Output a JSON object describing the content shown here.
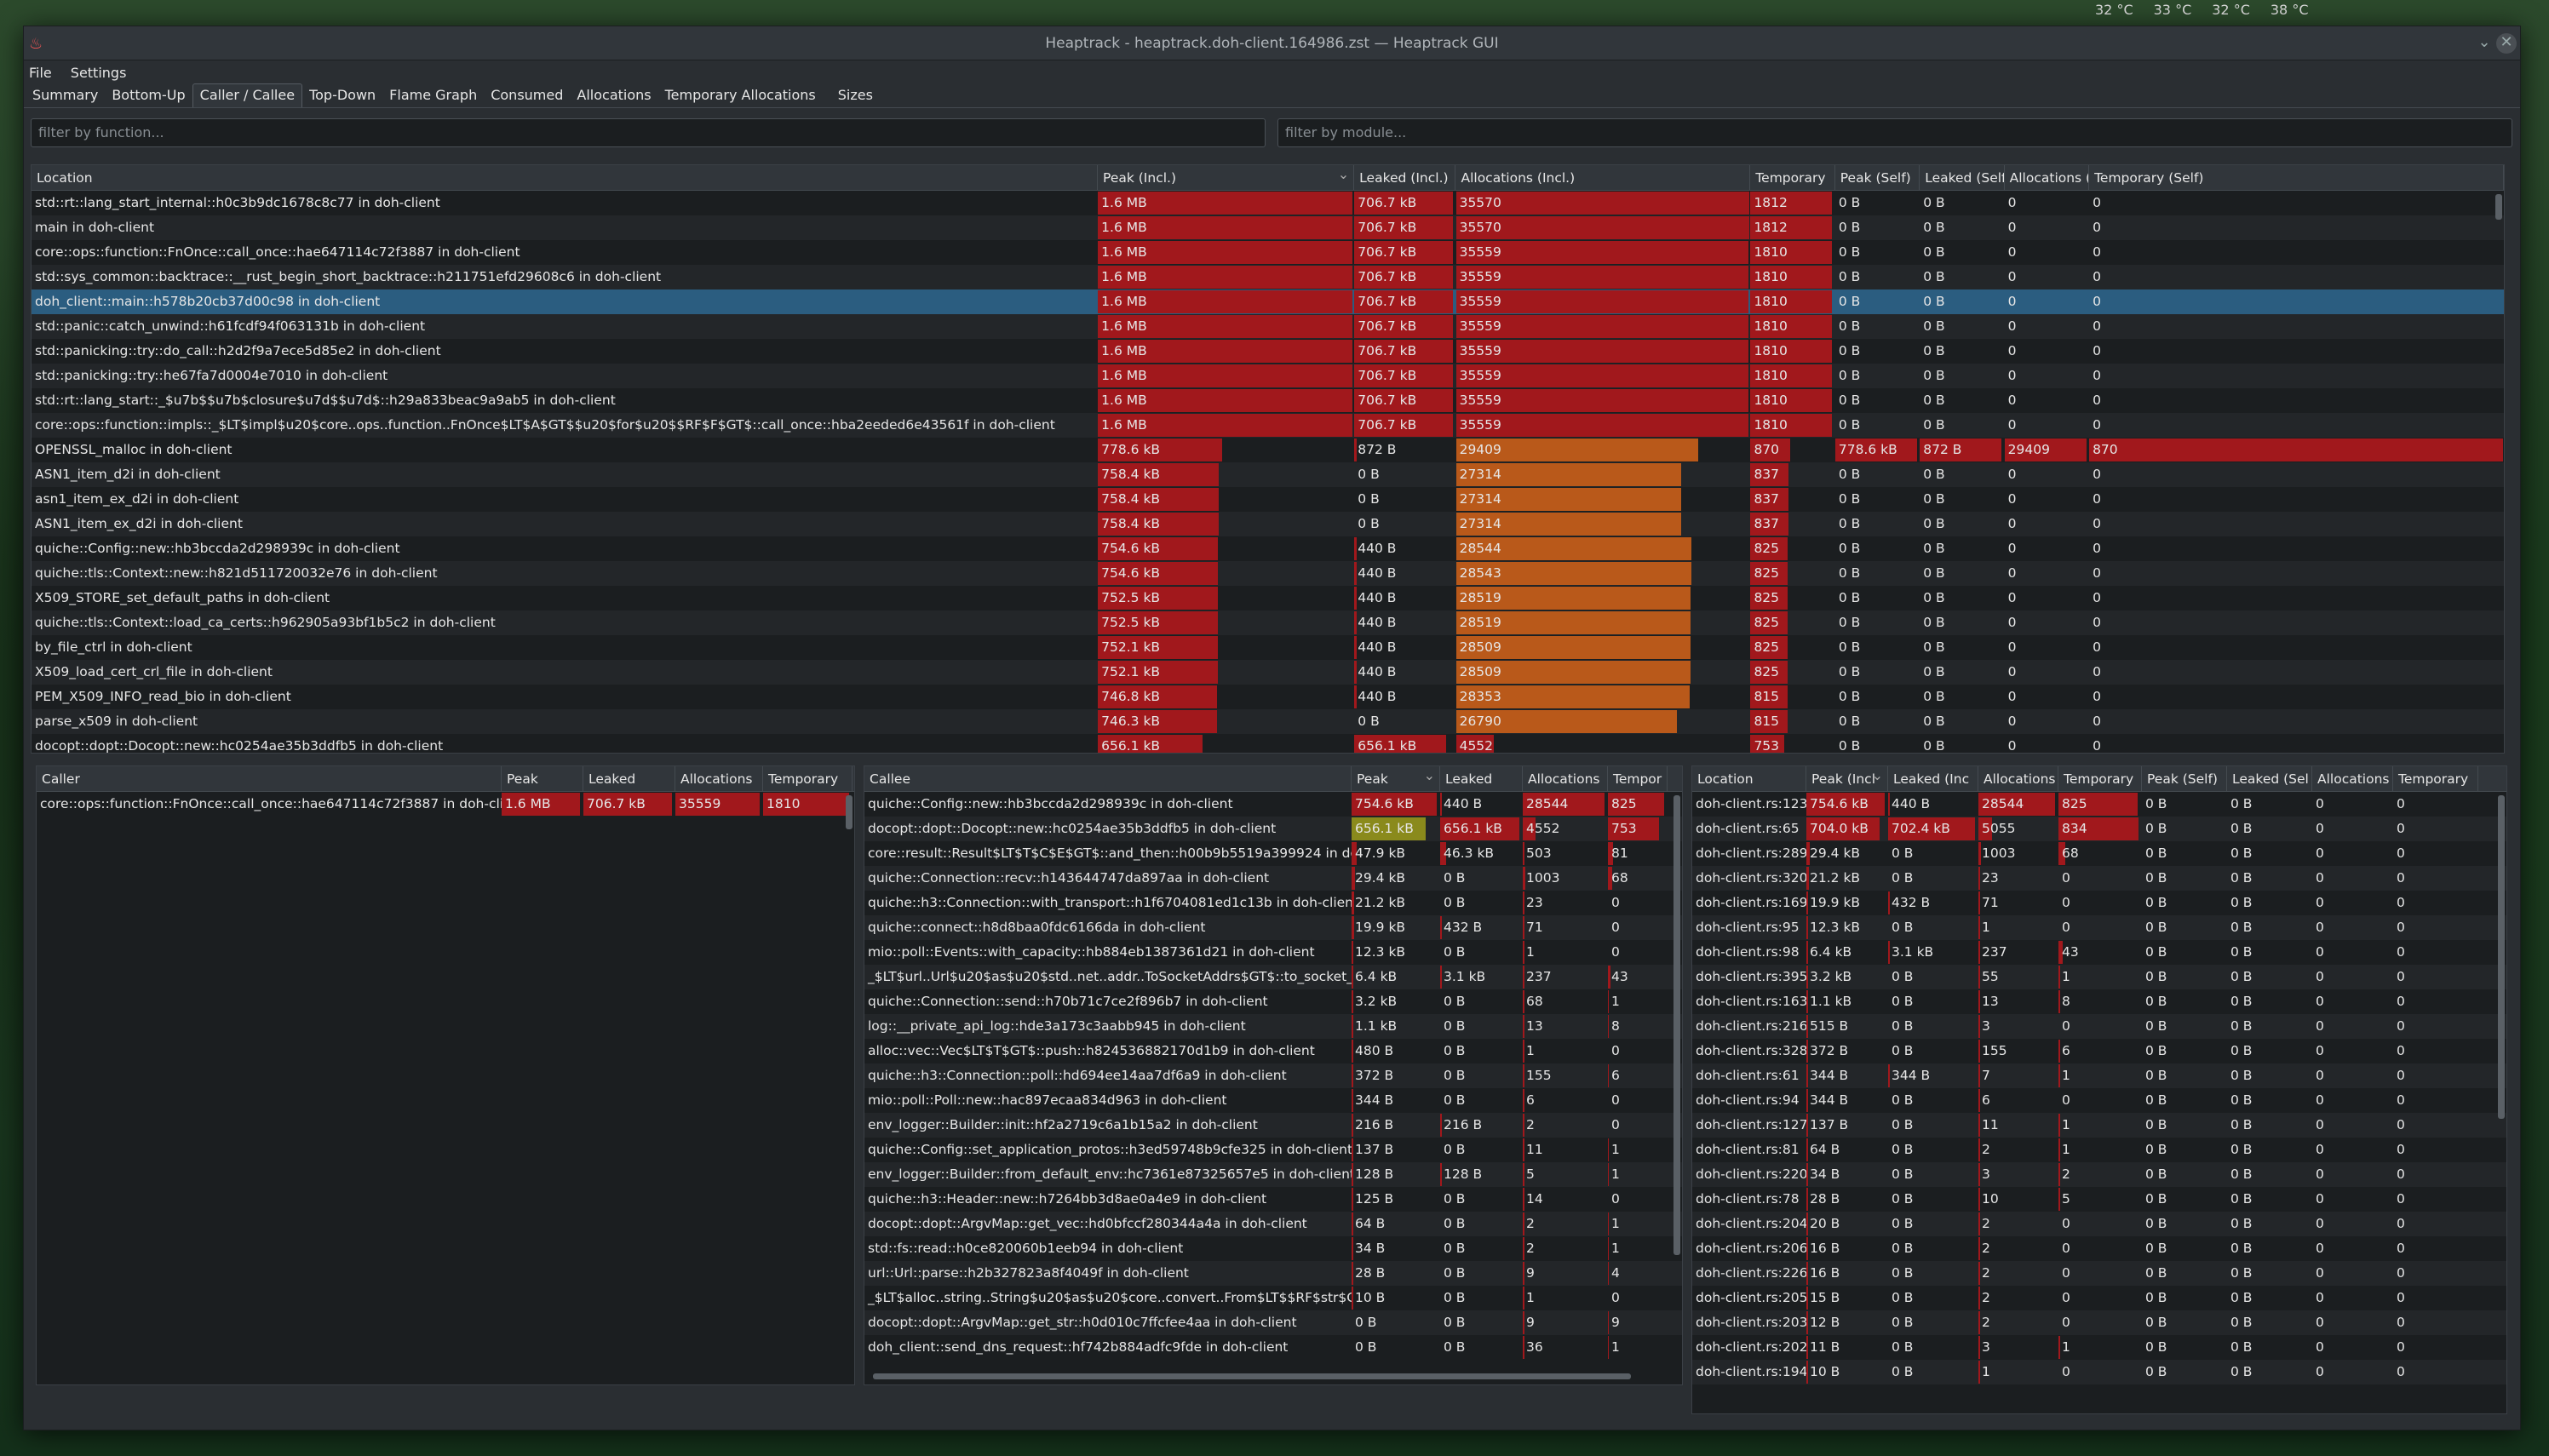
{
  "desktop": {
    "temps": [
      "32 °C",
      "33 °C",
      "32 °C",
      "38 °C"
    ]
  },
  "window": {
    "title": "Heaptrack - heaptrack.doh-client.164986.zst — Heaptrack GUI"
  },
  "menu": [
    "File",
    "Settings"
  ],
  "tabs": [
    "Summary",
    "Bottom-Up",
    "Caller / Callee",
    "Top-Down",
    "Flame Graph",
    "Consumed",
    "Allocations",
    "Temporary Allocations",
    "Sizes"
  ],
  "active_tab": "Caller / Callee",
  "filters": {
    "function_placeholder": "filter by function...",
    "module_placeholder": "filter by module..."
  },
  "main": {
    "headers": [
      "Location",
      "Peak (Incl.)",
      "Leaked (Incl.)",
      "Allocations (Incl.)",
      "Temporary",
      "Peak (Self)",
      "Leaked (Self)",
      "Allocations (",
      "Temporary (Self)"
    ],
    "rows": [
      [
        "std::rt::lang_start_internal::h0c3b9dc1678c8c77 in doh-client",
        "1.6 MB",
        "706.7 kB",
        "35570",
        "1812",
        "0 B",
        "0 B",
        "0",
        "0"
      ],
      [
        "main in doh-client",
        "1.6 MB",
        "706.7 kB",
        "35570",
        "1812",
        "0 B",
        "0 B",
        "0",
        "0"
      ],
      [
        "core::ops::function::FnOnce::call_once::hae647114c72f3887 in doh-client",
        "1.6 MB",
        "706.7 kB",
        "35559",
        "1810",
        "0 B",
        "0 B",
        "0",
        "0"
      ],
      [
        "std::sys_common::backtrace::__rust_begin_short_backtrace::h211751efd29608c6 in doh-client",
        "1.6 MB",
        "706.7 kB",
        "35559",
        "1810",
        "0 B",
        "0 B",
        "0",
        "0"
      ],
      [
        "doh_client::main::h578b20cb37d00c98 in doh-client",
        "1.6 MB",
        "706.7 kB",
        "35559",
        "1810",
        "0 B",
        "0 B",
        "0",
        "0"
      ],
      [
        "std::panic::catch_unwind::h61fcdf94f063131b in doh-client",
        "1.6 MB",
        "706.7 kB",
        "35559",
        "1810",
        "0 B",
        "0 B",
        "0",
        "0"
      ],
      [
        "std::panicking::try::do_call::h2d2f9a7ece5d85e2 in doh-client",
        "1.6 MB",
        "706.7 kB",
        "35559",
        "1810",
        "0 B",
        "0 B",
        "0",
        "0"
      ],
      [
        "std::panicking::try::he67fa7d0004e7010 in doh-client",
        "1.6 MB",
        "706.7 kB",
        "35559",
        "1810",
        "0 B",
        "0 B",
        "0",
        "0"
      ],
      [
        "std::rt::lang_start::_$u7b$$u7b$closure$u7d$$u7d$::h29a833beac9a9ab5 in doh-client",
        "1.6 MB",
        "706.7 kB",
        "35559",
        "1810",
        "0 B",
        "0 B",
        "0",
        "0"
      ],
      [
        "core::ops::function::impls::_$LT$impl$u20$core..ops..function..FnOnce$LT$A$GT$$u20$for$u20$$RF$F$GT$::call_once::hba2eeded6e43561f in doh-client",
        "1.6 MB",
        "706.7 kB",
        "35559",
        "1810",
        "0 B",
        "0 B",
        "0",
        "0"
      ],
      [
        "OPENSSL_malloc in doh-client",
        "778.6 kB",
        "872 B",
        "29409",
        "870",
        "778.6 kB",
        "872 B",
        "29409",
        "870"
      ],
      [
        "ASN1_item_d2i in doh-client",
        "758.4 kB",
        "0 B",
        "27314",
        "837",
        "0 B",
        "0 B",
        "0",
        "0"
      ],
      [
        "asn1_item_ex_d2i in doh-client",
        "758.4 kB",
        "0 B",
        "27314",
        "837",
        "0 B",
        "0 B",
        "0",
        "0"
      ],
      [
        "ASN1_item_ex_d2i in doh-client",
        "758.4 kB",
        "0 B",
        "27314",
        "837",
        "0 B",
        "0 B",
        "0",
        "0"
      ],
      [
        "quiche::Config::new::hb3bccda2d298939c in doh-client",
        "754.6 kB",
        "440 B",
        "28544",
        "825",
        "0 B",
        "0 B",
        "0",
        "0"
      ],
      [
        "quiche::tls::Context::new::h821d511720032e76 in doh-client",
        "754.6 kB",
        "440 B",
        "28543",
        "825",
        "0 B",
        "0 B",
        "0",
        "0"
      ],
      [
        "X509_STORE_set_default_paths in doh-client",
        "752.5 kB",
        "440 B",
        "28519",
        "825",
        "0 B",
        "0 B",
        "0",
        "0"
      ],
      [
        "quiche::tls::Context::load_ca_certs::h962905a93bf1b5c2 in doh-client",
        "752.5 kB",
        "440 B",
        "28519",
        "825",
        "0 B",
        "0 B",
        "0",
        "0"
      ],
      [
        "by_file_ctrl in doh-client",
        "752.1 kB",
        "440 B",
        "28509",
        "825",
        "0 B",
        "0 B",
        "0",
        "0"
      ],
      [
        "X509_load_cert_crl_file in doh-client",
        "752.1 kB",
        "440 B",
        "28509",
        "825",
        "0 B",
        "0 B",
        "0",
        "0"
      ],
      [
        "PEM_X509_INFO_read_bio in doh-client",
        "746.8 kB",
        "440 B",
        "28353",
        "815",
        "0 B",
        "0 B",
        "0",
        "0"
      ],
      [
        "parse_x509 in doh-client",
        "746.3 kB",
        "0 B",
        "26790",
        "815",
        "0 B",
        "0 B",
        "0",
        "0"
      ],
      [
        "docopt::dopt::Docopt::new::hc0254ae35b3ddfb5 in doh-client",
        "656.1 kB",
        "656.1 kB",
        "4552",
        "753",
        "0 B",
        "0 B",
        "0",
        "0"
      ]
    ]
  },
  "caller": {
    "headers": [
      "Caller",
      "Peak",
      "Leaked",
      "Allocations",
      "Temporary"
    ],
    "rows": [
      [
        "core::ops::function::FnOnce::call_once::hae647114c72f3887 in doh-client",
        "1.6 MB",
        "706.7 kB",
        "35559",
        "1810"
      ]
    ]
  },
  "callee": {
    "headers": [
      "Callee",
      "Peak",
      "Leaked",
      "Allocations",
      "Tempor"
    ],
    "rows": [
      [
        "quiche::Config::new::hb3bccda2d298939c in doh-client",
        "754.6 kB",
        "440 B",
        "28544",
        "825"
      ],
      [
        "docopt::dopt::Docopt::new::hc0254ae35b3ddfb5 in doh-client",
        "656.1 kB",
        "656.1 kB",
        "4552",
        "753"
      ],
      [
        "core::result::Result$LT$T$C$E$GT$::and_then::h00b9b5519a399924 in doh-...",
        "47.9 kB",
        "46.3 kB",
        "503",
        "81"
      ],
      [
        "quiche::Connection::recv::h143644747da897aa in doh-client",
        "29.4 kB",
        "0 B",
        "1003",
        "68"
      ],
      [
        "quiche::h3::Connection::with_transport::h1f6704081ed1c13b in doh-client",
        "21.2 kB",
        "0 B",
        "23",
        "0"
      ],
      [
        "quiche::connect::h8d8baa0fdc6166da in doh-client",
        "19.9 kB",
        "432 B",
        "71",
        "0"
      ],
      [
        "mio::poll::Events::with_capacity::hb884eb1387361d21 in doh-client",
        "12.3 kB",
        "0 B",
        "1",
        "0"
      ],
      [
        "_$LT$url..Url$u20$as$u20$std..net..addr..ToSocketAddrs$GT$::to_socket_ad...",
        "6.4 kB",
        "3.1 kB",
        "237",
        "43"
      ],
      [
        "quiche::Connection::send::h70b71c7ce2f896b7 in doh-client",
        "3.2 kB",
        "0 B",
        "68",
        "1"
      ],
      [
        "log::__private_api_log::hde3a173c3aabb945 in doh-client",
        "1.1 kB",
        "0 B",
        "13",
        "8"
      ],
      [
        "alloc::vec::Vec$LT$T$GT$::push::h824536882170d1b9 in doh-client",
        "480 B",
        "0 B",
        "1",
        "0"
      ],
      [
        "quiche::h3::Connection::poll::hd694ee14aa7df6a9 in doh-client",
        "372 B",
        "0 B",
        "155",
        "6"
      ],
      [
        "mio::poll::Poll::new::hac897ecaa834d963 in doh-client",
        "344 B",
        "0 B",
        "6",
        "0"
      ],
      [
        "env_logger::Builder::init::hf2a2719c6a1b15a2 in doh-client",
        "216 B",
        "216 B",
        "2",
        "0"
      ],
      [
        "quiche::Config::set_application_protos::h3ed59748b9cfe325 in doh-client",
        "137 B",
        "0 B",
        "11",
        "1"
      ],
      [
        "env_logger::Builder::from_default_env::hc7361e87325657e5 in doh-client",
        "128 B",
        "128 B",
        "5",
        "1"
      ],
      [
        "quiche::h3::Header::new::h7264bb3d8ae0a4e9 in doh-client",
        "125 B",
        "0 B",
        "14",
        "0"
      ],
      [
        "docopt::dopt::ArgvMap::get_vec::hd0bfccf280344a4a in doh-client",
        "64 B",
        "0 B",
        "2",
        "1"
      ],
      [
        "std::fs::read::h0ce820060b1eeb94 in doh-client",
        "34 B",
        "0 B",
        "2",
        "1"
      ],
      [
        "url::Url::parse::h2b327823a8f4049f in doh-client",
        "28 B",
        "0 B",
        "9",
        "4"
      ],
      [
        "_$LT$alloc..string..String$u20$as$u20$core..convert..From$LT$$RF$str$GT...",
        "10 B",
        "0 B",
        "1",
        "0"
      ],
      [
        "docopt::dopt::ArgvMap::get_str::h0d010c7ffcfee4aa in doh-client",
        "0 B",
        "0 B",
        "9",
        "9"
      ],
      [
        "doh_client::send_dns_request::hf742b884adfc9fde in doh-client",
        "0 B",
        "0 B",
        "36",
        "1"
      ]
    ]
  },
  "locations": {
    "headers": [
      "Location",
      "Peak (Incl",
      "Leaked (Inc",
      "Allocations",
      "Temporary",
      "Peak (Self)",
      "Leaked (Sel",
      "Allocations",
      "Temporary"
    ],
    "rows": [
      [
        "doh-client.rs:123",
        "754.6 kB",
        "440 B",
        "28544",
        "825",
        "0 B",
        "0 B",
        "0",
        "0"
      ],
      [
        "doh-client.rs:65",
        "704.0 kB",
        "702.4 kB",
        "5055",
        "834",
        "0 B",
        "0 B",
        "0",
        "0"
      ],
      [
        "doh-client.rs:289",
        "29.4 kB",
        "0 B",
        "1003",
        "68",
        "0 B",
        "0 B",
        "0",
        "0"
      ],
      [
        "doh-client.rs:320",
        "21.2 kB",
        "0 B",
        "23",
        "0",
        "0 B",
        "0 B",
        "0",
        "0"
      ],
      [
        "doh-client.rs:169",
        "19.9 kB",
        "432 B",
        "71",
        "0",
        "0 B",
        "0 B",
        "0",
        "0"
      ],
      [
        "doh-client.rs:95",
        "12.3 kB",
        "0 B",
        "1",
        "0",
        "0 B",
        "0 B",
        "0",
        "0"
      ],
      [
        "doh-client.rs:98",
        "6.4 kB",
        "3.1 kB",
        "237",
        "43",
        "0 B",
        "0 B",
        "0",
        "0"
      ],
      [
        "doh-client.rs:395",
        "3.2 kB",
        "0 B",
        "55",
        "1",
        "0 B",
        "0 B",
        "0",
        "0"
      ],
      [
        "doh-client.rs:163",
        "1.1 kB",
        "0 B",
        "13",
        "8",
        "0 B",
        "0 B",
        "0",
        "0"
      ],
      [
        "doh-client.rs:216",
        "515 B",
        "0 B",
        "3",
        "0",
        "0 B",
        "0 B",
        "0",
        "0"
      ],
      [
        "doh-client.rs:328",
        "372 B",
        "0 B",
        "155",
        "6",
        "0 B",
        "0 B",
        "0",
        "0"
      ],
      [
        "doh-client.rs:61",
        "344 B",
        "344 B",
        "7",
        "1",
        "0 B",
        "0 B",
        "0",
        "0"
      ],
      [
        "doh-client.rs:94",
        "344 B",
        "0 B",
        "6",
        "0",
        "0 B",
        "0 B",
        "0",
        "0"
      ],
      [
        "doh-client.rs:127",
        "137 B",
        "0 B",
        "11",
        "1",
        "0 B",
        "0 B",
        "0",
        "0"
      ],
      [
        "doh-client.rs:81",
        "64 B",
        "0 B",
        "2",
        "1",
        "0 B",
        "0 B",
        "0",
        "0"
      ],
      [
        "doh-client.rs:220",
        "34 B",
        "0 B",
        "3",
        "2",
        "0 B",
        "0 B",
        "0",
        "0"
      ],
      [
        "doh-client.rs:78",
        "28 B",
        "0 B",
        "10",
        "5",
        "0 B",
        "0 B",
        "0",
        "0"
      ],
      [
        "doh-client.rs:204",
        "20 B",
        "0 B",
        "2",
        "0",
        "0 B",
        "0 B",
        "0",
        "0"
      ],
      [
        "doh-client.rs:206",
        "16 B",
        "0 B",
        "2",
        "0",
        "0 B",
        "0 B",
        "0",
        "0"
      ],
      [
        "doh-client.rs:226",
        "16 B",
        "0 B",
        "2",
        "0",
        "0 B",
        "0 B",
        "0",
        "0"
      ],
      [
        "doh-client.rs:205",
        "15 B",
        "0 B",
        "2",
        "0",
        "0 B",
        "0 B",
        "0",
        "0"
      ],
      [
        "doh-client.rs:203",
        "12 B",
        "0 B",
        "2",
        "0",
        "0 B",
        "0 B",
        "0",
        "0"
      ],
      [
        "doh-client.rs:202",
        "11 B",
        "0 B",
        "3",
        "1",
        "0 B",
        "0 B",
        "0",
        "0"
      ],
      [
        "doh-client.rs:194",
        "10 B",
        "0 B",
        "1",
        "0",
        "0 B",
        "0 B",
        "0",
        "0"
      ]
    ]
  },
  "colors": {
    "red": "#a1181c",
    "olive": "#8a8a1c",
    "orange": "#b9591a",
    "selection": "#2b5d80"
  }
}
